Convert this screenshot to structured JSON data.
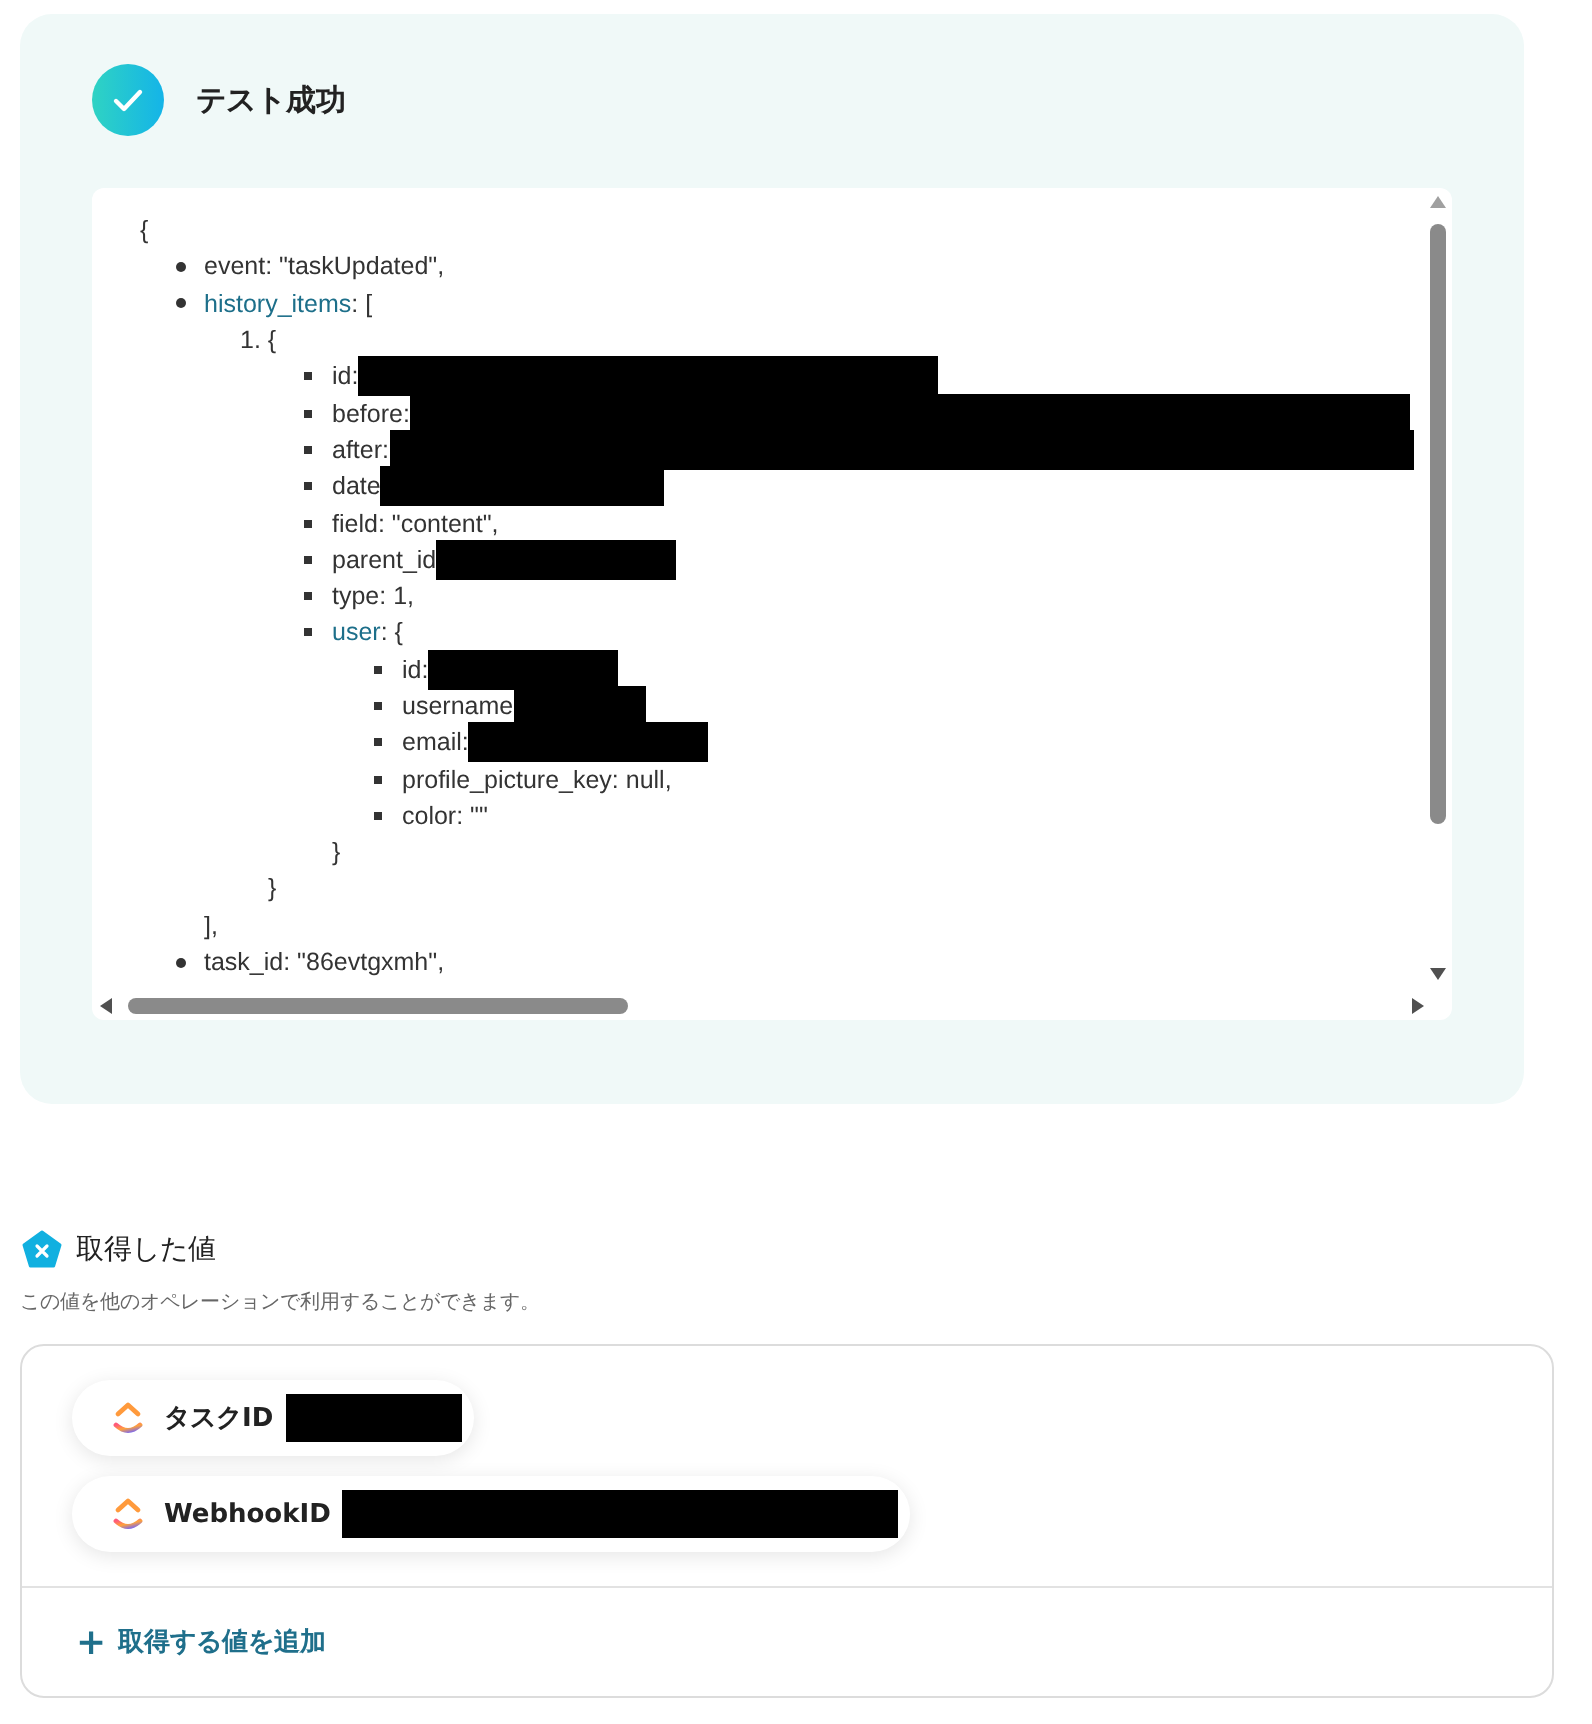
{
  "result": {
    "title": "テスト成功",
    "json_view": {
      "open": "{",
      "items": [
        {
          "key": "event",
          "value": ": \"taskUpdated\",",
          "expandable": false
        },
        {
          "key": "history_items",
          "value": ": [",
          "expandable": true,
          "close": "],",
          "children": [
            {
              "index": "1.",
              "open": "{",
              "close": "}",
              "fields": [
                {
                  "key": "id:",
                  "redacted": true
                },
                {
                  "key": "before:",
                  "redacted": true
                },
                {
                  "key": "after:",
                  "redacted": true
                },
                {
                  "key": "date",
                  "redacted": true
                },
                {
                  "key": "field",
                  "value": ": \"content\","
                },
                {
                  "key": "parent_id",
                  "redacted": true
                },
                {
                  "key": "type",
                  "value": ": 1,"
                },
                {
                  "key": "user",
                  "value": ": {",
                  "expandable": true,
                  "close": "}",
                  "fields": [
                    {
                      "key": "id:",
                      "redacted": true
                    },
                    {
                      "key": "username",
                      "redacted": true
                    },
                    {
                      "key": "email:",
                      "redacted": true
                    },
                    {
                      "key": "profile_picture_key",
                      "value": ": null,"
                    },
                    {
                      "key": "color",
                      "value": ": \"\""
                    }
                  ]
                }
              ]
            }
          ]
        },
        {
          "key": "task_id",
          "value": ": \"86evtgxmh\",",
          "expandable": false
        }
      ]
    }
  },
  "values": {
    "title": "取得した値",
    "subtitle": "この値を他のオペレーションで利用することができます。",
    "chips": [
      {
        "label": "タスクID",
        "redacted": true
      },
      {
        "label": "WebhookID",
        "redacted": true
      }
    ],
    "add_button": "取得する値を追加",
    "add_icon": "+"
  }
}
